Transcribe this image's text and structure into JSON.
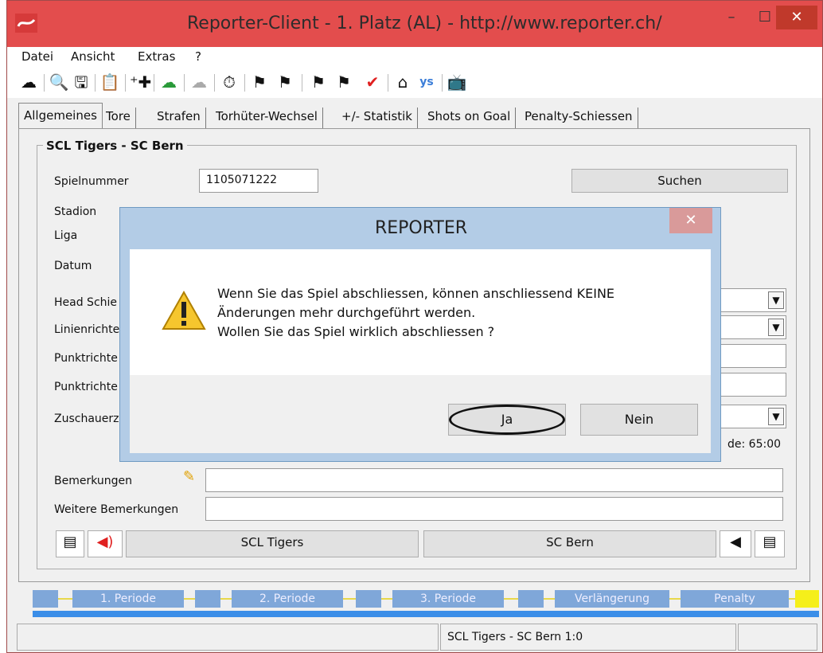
{
  "window": {
    "title": "Reporter-Client  -  1. Platz (AL)  -  http://www.reporter.ch/",
    "min": "–",
    "max": "☐",
    "close": "✕"
  },
  "menu": [
    "Datei",
    "Ansicht",
    "Extras",
    "?"
  ],
  "toolbar_icons": [
    "cloud-download",
    "search",
    "save",
    "clipboard",
    "add-player",
    "cloud-upload",
    "cloud-disabled",
    "stopwatch",
    "team-a",
    "team-b",
    "team-c",
    "team-d",
    "checkmark",
    "home",
    "ys",
    "tv"
  ],
  "tabs": [
    "Allgemeines",
    "Tore",
    "Strafen",
    "Torhüter-Wechsel",
    "+/- Statistik",
    "Shots on Goal",
    "Penalty-Schiessen"
  ],
  "group": {
    "title": "SCL Tigers - SC Bern",
    "spielnummer_label": "Spielnummer",
    "spielnummer_value": "1105071222",
    "suchen": "Suchen",
    "stadion_label": "Stadion",
    "liga_label": "Liga",
    "datum_label": "Datum",
    "head_label": "Head Schie",
    "linien_label": "Linienrichte",
    "punkt1_label": "Punktrichte",
    "punkt2_label": "Punktrichte",
    "zuschauer_label": "Zuschauerz",
    "time_text": "de: 65:00",
    "bemerkungen_label": "Bemerkungen",
    "weitere_label": "Weitere Bemerkungen",
    "team_home": "SCL Tigers",
    "team_away": "SC Bern"
  },
  "periods": [
    "1. Periode",
    "2. Periode",
    "3. Periode",
    "Verlängerung",
    "Penalty"
  ],
  "status": {
    "left": "",
    "middle": "SCL Tigers - SC Bern 1:0",
    "right": ""
  },
  "dialog": {
    "title": "REPORTER",
    "close": "✕",
    "line1": "Wenn Sie das Spiel abschliessen, können anschliessend KEINE",
    "line2": "Änderungen mehr durchgeführt werden.",
    "line3": "Wollen Sie das Spiel wirklich abschliessen ?",
    "yes": "Ja",
    "no": "Nein"
  },
  "colors": {
    "titlebar": "#e34d4d",
    "period_block": "#7fa7d9",
    "period_bar": "#3b8ee8",
    "penalty_marker": "#f5ef1a"
  }
}
